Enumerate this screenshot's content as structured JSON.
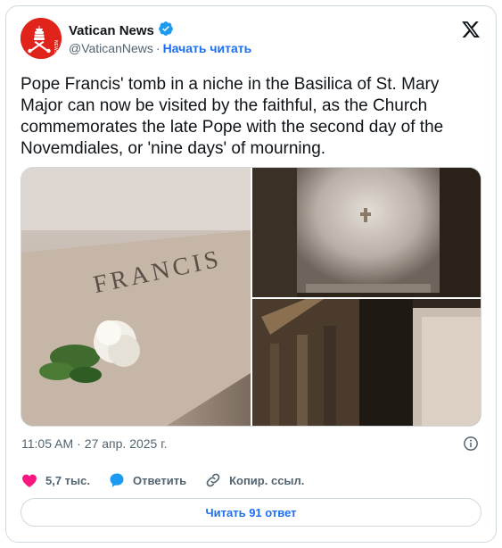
{
  "author": {
    "display_name": "Vatican News",
    "handle": "@VaticanNews",
    "separator": "·",
    "follow_label": "Начать читать",
    "verified": true,
    "brand_color": "#e0241b"
  },
  "tweet": {
    "text": "Pope Francis' tomb in a niche in the Basilica of St. Mary Major can now be visited by the faithful, as the Church commemorates the late Pope with the second day of the Novemdiales, or 'nine days' of mourning.",
    "time": "11:05 AM",
    "dot": "·",
    "date": "27 апр. 2025 г."
  },
  "media": {
    "tomb_inscription": "FRANCIS",
    "count": 3
  },
  "actions": {
    "likes": "5,7 тыс.",
    "reply_label": "Ответить",
    "copy_link_label": "Копир. ссыл.",
    "read_replies_label": "Читать 91 ответ"
  },
  "colors": {
    "link": "#1d6ff2",
    "like": "#f91880",
    "reply_bubble": "#1d9bf0",
    "muted": "#536471",
    "border": "#cfd9de"
  },
  "icons": [
    "vatican-news-logo-icon",
    "verified-badge-icon",
    "x-logo-icon",
    "info-icon",
    "heart-icon",
    "reply-bubble-icon",
    "link-icon"
  ]
}
